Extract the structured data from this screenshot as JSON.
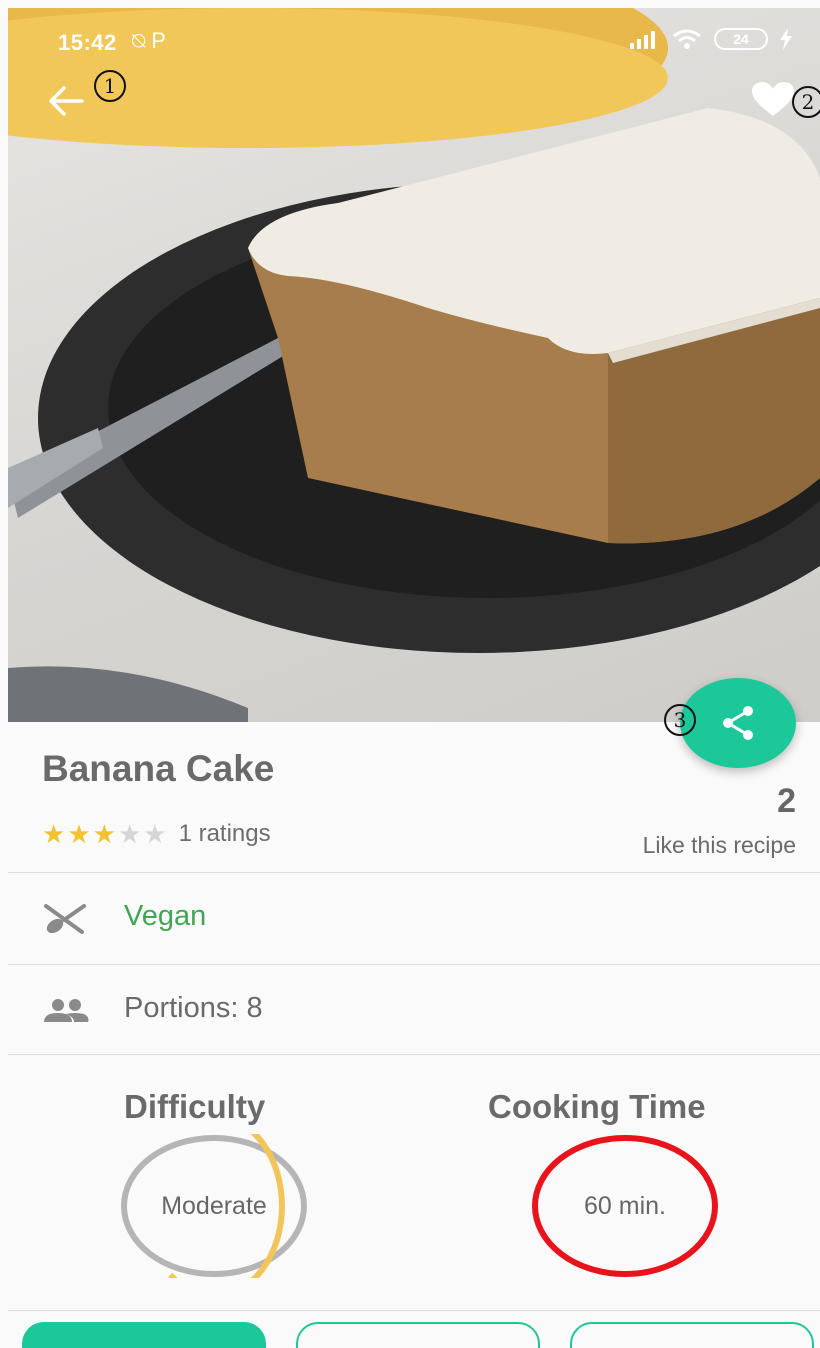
{
  "status_bar": {
    "time": "15:42",
    "time_icons": "⍉ P",
    "battery": "24"
  },
  "recipe": {
    "title": "Banana Cake",
    "rating_stars_filled": 3,
    "rating_stars_total": 5,
    "ratings_label": "1 ratings",
    "likes_count": "2",
    "likes_label": "Like this recipe",
    "category": "Vegan",
    "portions": "Portions: 8"
  },
  "metrics": {
    "difficulty_title": "Difficulty",
    "difficulty_value": "Moderate",
    "difficulty_progress": 0.6,
    "cooking_title": "Cooking Time",
    "cooking_value": "60 min."
  },
  "annotations": {
    "back": "1",
    "favorite": "2",
    "share": "3"
  },
  "colors": {
    "accent": "#1cc79a",
    "star": "#f2c230",
    "category": "#3fa752",
    "difficulty_ring": "#f2c55a",
    "cooking_ring": "#e8141b"
  },
  "icons": {
    "back": "arrow-left-icon",
    "favorite": "heart-icon",
    "share": "share-icon",
    "category": "utensils-icon",
    "portions": "people-icon"
  }
}
